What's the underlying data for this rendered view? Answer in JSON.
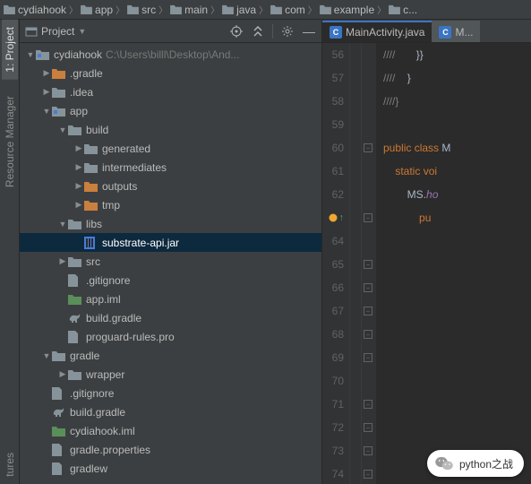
{
  "breadcrumb": [
    "cydiahook",
    "app",
    "src",
    "main",
    "java",
    "com",
    "example",
    "c..."
  ],
  "panel": {
    "title": "Project"
  },
  "tree": {
    "root": {
      "label": "cydiahook",
      "hint": "C:\\Users\\billl\\Desktop\\And..."
    },
    "gradleDir": ".gradle",
    "ideaDir": ".idea",
    "app": "app",
    "build": "build",
    "generated": "generated",
    "intermediates": "intermediates",
    "outputs": "outputs",
    "tmp": "tmp",
    "libs": "libs",
    "substrate": "substrate-api.jar",
    "src": "src",
    "gitignore1": ".gitignore",
    "appIml": "app.iml",
    "buildGradle1": "build.gradle",
    "proguard": "proguard-rules.pro",
    "gradleFolder": "gradle",
    "wrapper": "wrapper",
    "gitignore2": ".gitignore",
    "buildGradle2": "build.gradle",
    "cydiahookIml": "cydiahook.iml",
    "gradleProps": "gradle.properties",
    "gradlew": "gradlew"
  },
  "tabs": {
    "main": "MainActivity.java",
    "other": "M..."
  },
  "sideTabs": {
    "project": "1: Project",
    "resource": "Resource Manager",
    "structures": "tures"
  },
  "gutterStart": 56,
  "code": {
    "l56a": "////",
    "l56b": "}}",
    "l57a": "////",
    "l57b": "}",
    "l58": "////}",
    "l60a": "public class ",
    "l60b": "M",
    "l61a": "static ",
    "l61b": "voi",
    "l62a": "MS",
    "l62b": ".ho",
    "l62hook": "ho",
    "l63": "pu"
  },
  "wechat": "python之战"
}
